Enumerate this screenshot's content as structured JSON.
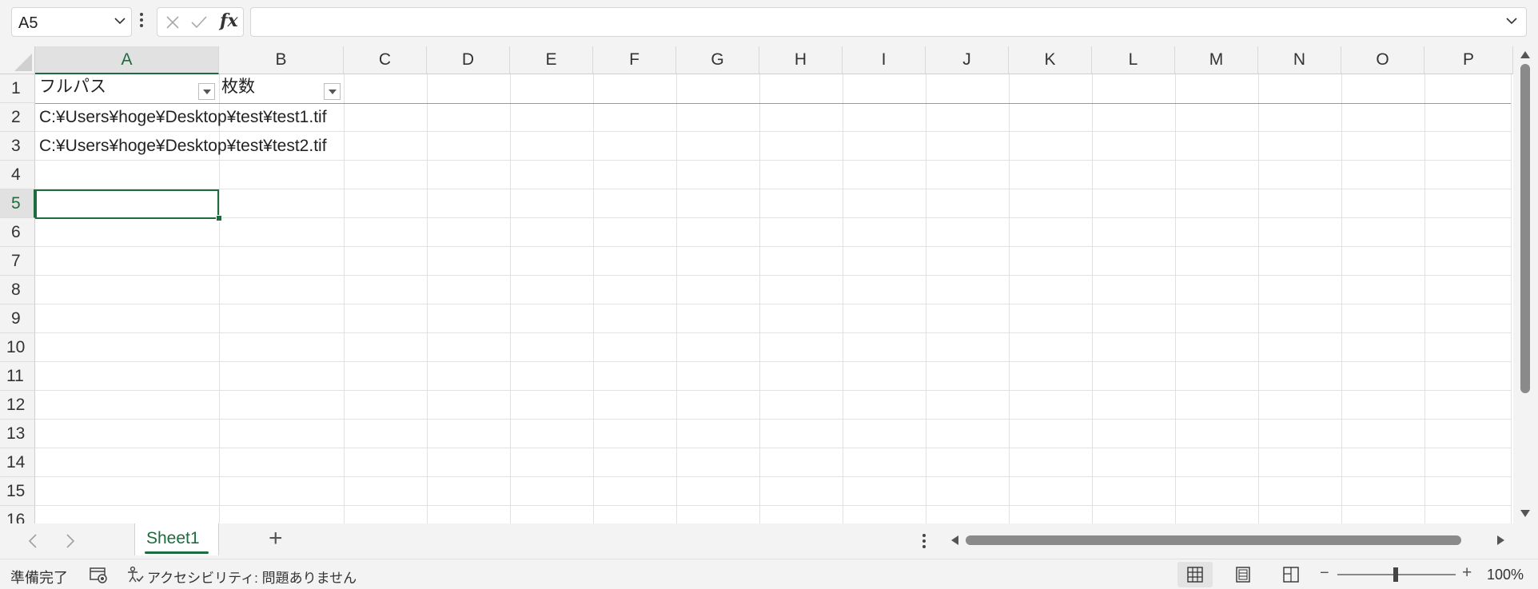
{
  "formula_bar": {
    "name_box": "A5",
    "fx_label": "fx",
    "formula_value": ""
  },
  "grid": {
    "columns": [
      "A",
      "B",
      "C",
      "D",
      "E",
      "F",
      "G",
      "H",
      "I",
      "J",
      "K",
      "L",
      "M",
      "N",
      "O",
      "P"
    ],
    "rows": [
      "1",
      "2",
      "3",
      "4",
      "5",
      "6",
      "7",
      "8",
      "9",
      "10",
      "11",
      "12",
      "13",
      "14",
      "15",
      "16"
    ],
    "selected_cell": "A5",
    "cells": {
      "A1": "フルパス",
      "B1": "枚数",
      "A2": "C:¥Users¥hoge¥Desktop¥test¥test1.tif",
      "A3": "C:¥Users¥hoge¥Desktop¥test¥test2.tif"
    }
  },
  "sheet_tabs": {
    "prev_icon": "chevron-left-icon",
    "next_icon": "chevron-right-icon",
    "active_sheet": "Sheet1",
    "add_label": "+"
  },
  "status_bar": {
    "ready": "準備完了",
    "accessibility": "アクセシビリティ: 問題ありません",
    "zoom_minus": "−",
    "zoom_plus": "+",
    "zoom_level": "100%"
  },
  "colors": {
    "accent": "#1e6b3d",
    "background": "#f3f3f3",
    "gridline": "#e2e2e2"
  }
}
